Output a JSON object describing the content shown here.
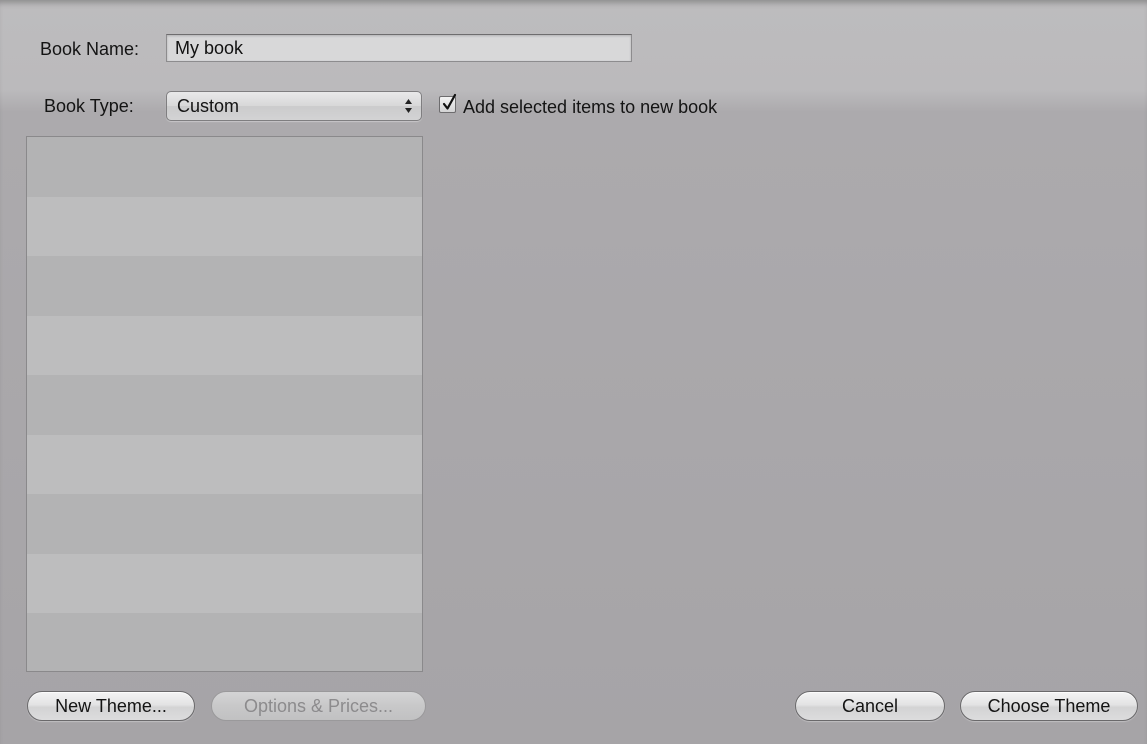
{
  "form": {
    "book_name_label": "Book Name:",
    "book_name_value": "My book",
    "book_type_label": "Book Type:",
    "book_type_value": "Custom",
    "add_selected_label": "Add selected items to new book",
    "add_selected_checked": true
  },
  "theme_list": {
    "rows": [
      "",
      "",
      "",
      "",
      "",
      "",
      "",
      "",
      ""
    ]
  },
  "buttons": {
    "new_theme": "New Theme...",
    "options_prices": "Options & Prices...",
    "cancel": "Cancel",
    "choose_theme": "Choose Theme"
  },
  "icons": {
    "popup_arrows": "up-down-arrows-icon",
    "checkmark": "checkmark-icon"
  }
}
